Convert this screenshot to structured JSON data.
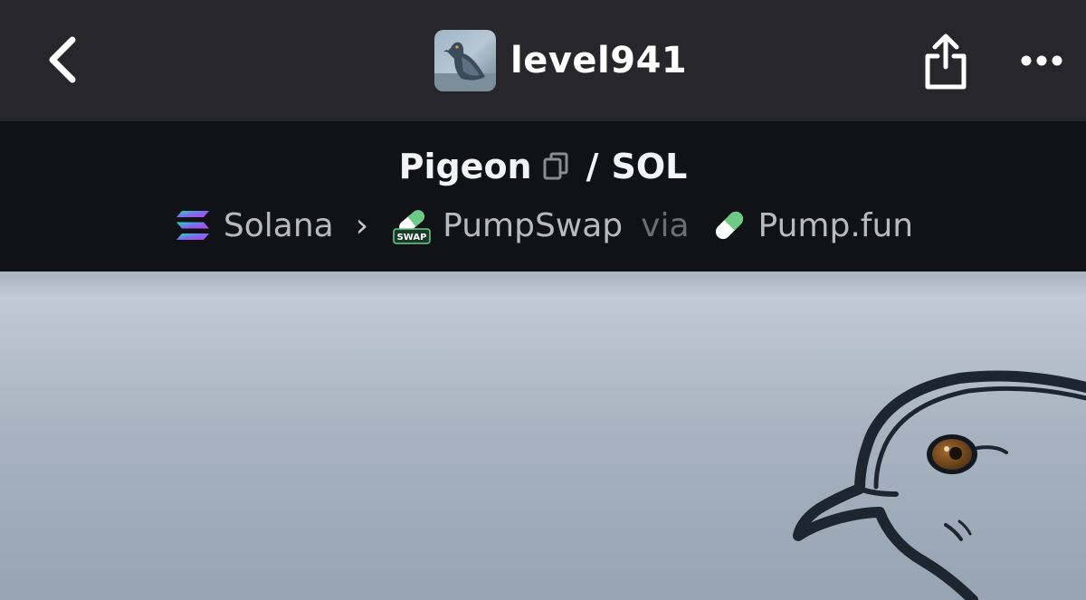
{
  "header": {
    "username": "level941",
    "icons": {
      "back": "chevron-left-icon",
      "share": "share-icon",
      "more": "more-horizontal-icon",
      "avatar": "pigeon-avatar"
    }
  },
  "pair": {
    "base_token": "Pigeon",
    "separator": "/",
    "quote_token": "SOL",
    "copy_icon": "copy-icon"
  },
  "route": {
    "chain": "Solana",
    "chain_icon": "solana-logo-icon",
    "chevron": "›",
    "dex": "PumpSwap",
    "dex_icon": "pumpswap-logo-icon",
    "via": "via",
    "launchpad": "Pump.fun",
    "launchpad_icon": "pumpfun-pill-icon"
  },
  "banner": {
    "image": "pigeon-banner-illustration"
  },
  "colors": {
    "header_bg": "#27272b",
    "pairbar_bg": "#111215",
    "text_primary": "#ffffff",
    "text_secondary": "#b9bac0",
    "text_muted": "#6d6e74",
    "banner_bg": "#a7b3c0"
  }
}
